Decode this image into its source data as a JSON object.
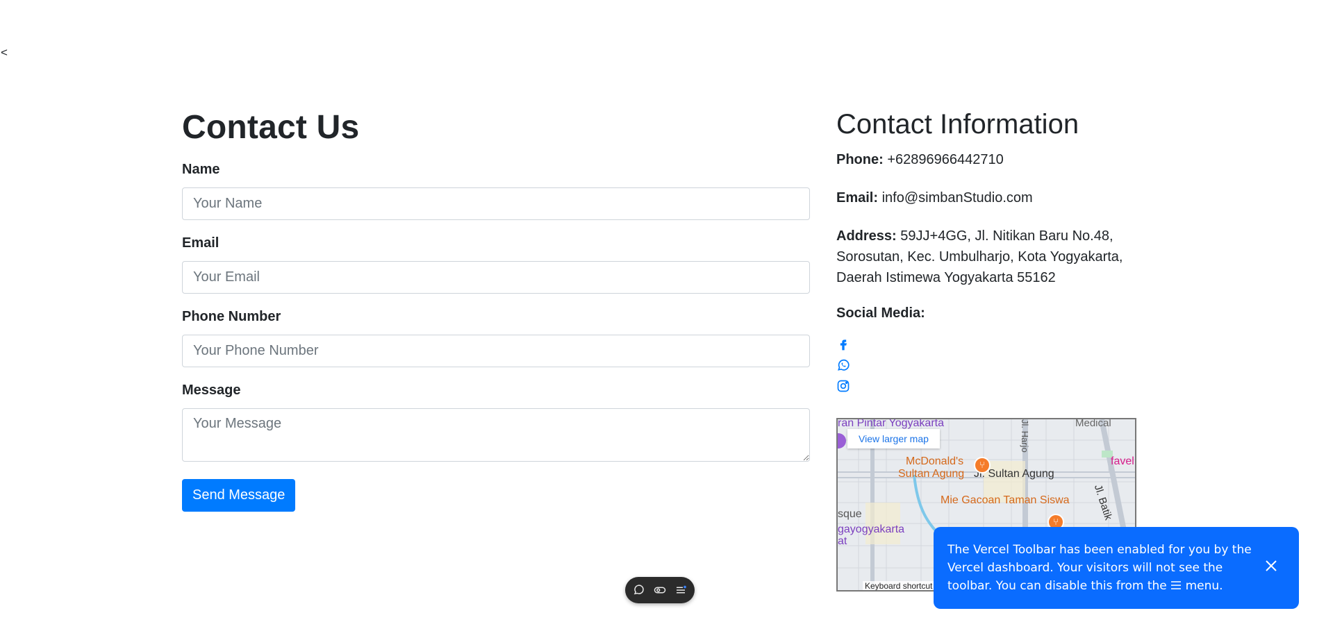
{
  "nav": {
    "back_label": "<"
  },
  "form": {
    "title": "Contact Us",
    "fields": [
      {
        "label": "Name",
        "placeholder": "Your Name"
      },
      {
        "label": "Email",
        "placeholder": "Your Email"
      },
      {
        "label": "Phone Number",
        "placeholder": "Your Phone Number"
      },
      {
        "label": "Message",
        "placeholder": "Your Message"
      }
    ],
    "submit_label": "Send Message"
  },
  "info": {
    "title": "Contact Information",
    "phone_label": "Phone:",
    "phone_value": "+62896966442710",
    "email_label": "Email:",
    "email_value": "info@simbanStudio.com",
    "address_label": "Address:",
    "address_value": "59JJ+4GG, Jl. Nitikan Baru No.48, Sorosutan, Kec. Umbulharjo, Kota Yogyakarta, Daerah Istimewa Yogyakarta 55162",
    "social_label": "Social Media:",
    "social_icons": [
      "facebook-icon",
      "whatsapp-icon",
      "instagram-icon"
    ],
    "accent_color": "#007bff"
  },
  "map": {
    "view_larger_label": "View larger map",
    "labels": {
      "top_left": "ran Pintar Yogyakarta",
      "medical": "Medical",
      "mcdonalds_1": "McDonald's",
      "mcdonalds_2": "Sultan Agung",
      "street": "Jl. Sultan Agung",
      "favel": "favel",
      "mie": "Mie Gacoan Taman Siswa",
      "sque": "sque",
      "yogyakarta": "gayogyakarta",
      "at": "at",
      "jl_harjo": "Jl. Harjo",
      "jl_batik": "Jl. Batik"
    },
    "shortcut_label": "Keyboard shortcut"
  },
  "toast": {
    "text_1": "The Vercel Toolbar has been enabled for you by the Vercel dashboard. Your visitors will not see the toolbar. You can disable this from the",
    "text_2": "menu."
  }
}
